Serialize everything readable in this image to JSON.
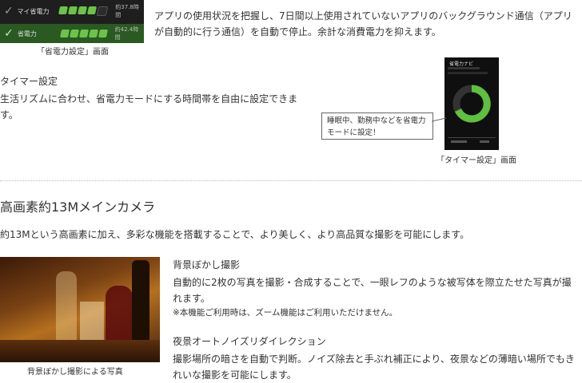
{
  "top_phone": {
    "rows": [
      {
        "name": "マイ省電力",
        "value": "約37.8時間"
      },
      {
        "name": "省電力",
        "value": "約42.4時間"
      }
    ],
    "caption": "「省電力設定」画面"
  },
  "auto_stop_text": "アプリの使用状況を把握し、7日間以上使用されていないアプリのバックグラウンド通信（アプリが自動的に行う通信）を自動で停止。余計な消費電力を抑えます。",
  "timer": {
    "heading": "タイマー設定",
    "body": "生活リズムに合わせ、省電力モードにする時間帯を自由に設定できます。",
    "phone_title": "省電力ナビ",
    "callout": "睡眠中、勤務中などを省電力モードに設定！",
    "caption": "「タイマー設定」画面"
  },
  "camera": {
    "title": "高画素約13Mメインカメラ",
    "intro": "約13Mという高画素に加え、多彩な機能を搭載することで、より美しく、より高品質な撮影を可能にします。",
    "photo_caption": "背景ぼかし撮影による写真",
    "features": [
      {
        "heading": "背景ぼかし撮影",
        "body": "自動的に2枚の写真を撮影・合成することで、一眼レフのような被写体を際立たせた写真が撮れます。",
        "note": "※本機能ご利用時は、ズーム機能はご利用いただけません。"
      },
      {
        "heading": "夜景オートノイズリダイレクション",
        "body": "撮影場所の暗さを自動で判断。ノイズ除去と手ぶれ補正により、夜景などの薄暗い場所でもきれいな撮影を可能にします。"
      }
    ]
  },
  "colors": {
    "accent_green": "#6cc24a",
    "text": "#333333"
  }
}
